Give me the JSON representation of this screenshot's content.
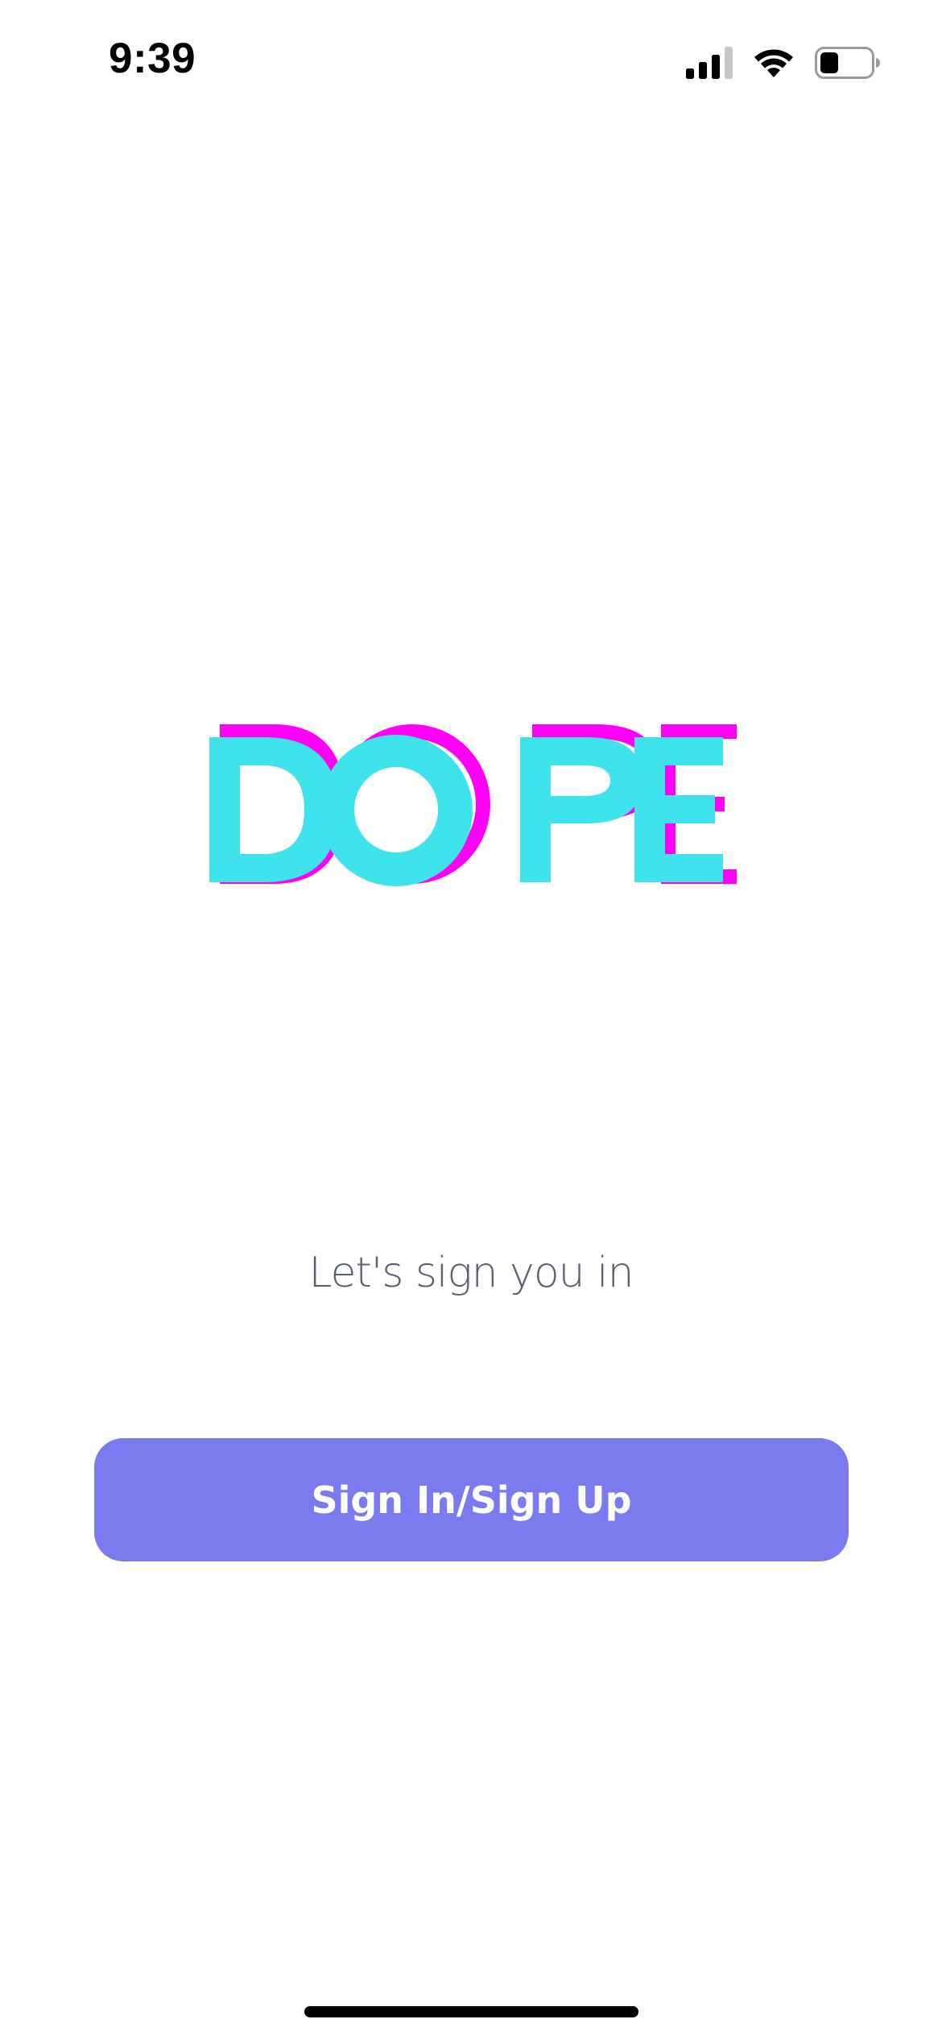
{
  "status_bar": {
    "time": "9:39",
    "signal_icon": "cellular-signal-icon",
    "wifi_icon": "wifi-icon",
    "battery_icon": "battery-icon",
    "battery_level": 0.35
  },
  "logo": {
    "text": "DOPE",
    "colors": {
      "primary": "#3ee3ec",
      "shadow": "#ff00f5"
    }
  },
  "subtitle": "Let's sign you in",
  "signin_button": {
    "label": "Sign In/Sign Up",
    "color": "#7b7bef"
  },
  "home_indicator": "home-indicator"
}
